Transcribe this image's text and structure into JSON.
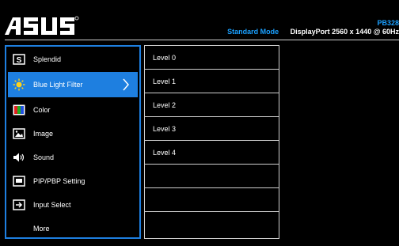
{
  "header": {
    "brand": "ASUS",
    "model": "PB328",
    "mode": "Standard Mode",
    "signal": "DisplayPort 2560 x 1440 @ 60Hz"
  },
  "colors": {
    "accent": "#1e7fe0",
    "header_text_blue": "#1aa0ff",
    "border": "#cfcfcf",
    "background": "#000000"
  },
  "main_menu": {
    "items": [
      {
        "label": "Splendid",
        "icon": "splendid-icon"
      },
      {
        "label": "Blue Light Filter",
        "icon": "sun-icon",
        "selected": true
      },
      {
        "label": "Color",
        "icon": "color-icon"
      },
      {
        "label": "Image",
        "icon": "image-icon"
      },
      {
        "label": "Sound",
        "icon": "speaker-icon"
      },
      {
        "label": "PIP/PBP Setting",
        "icon": "pip-icon"
      },
      {
        "label": "Input Select",
        "icon": "input-icon"
      },
      {
        "label": "More",
        "icon": ""
      }
    ]
  },
  "sub_menu": {
    "items": [
      "Level 0",
      "Level 1",
      "Level 2",
      "Level 3",
      "Level 4",
      "",
      "",
      ""
    ]
  }
}
